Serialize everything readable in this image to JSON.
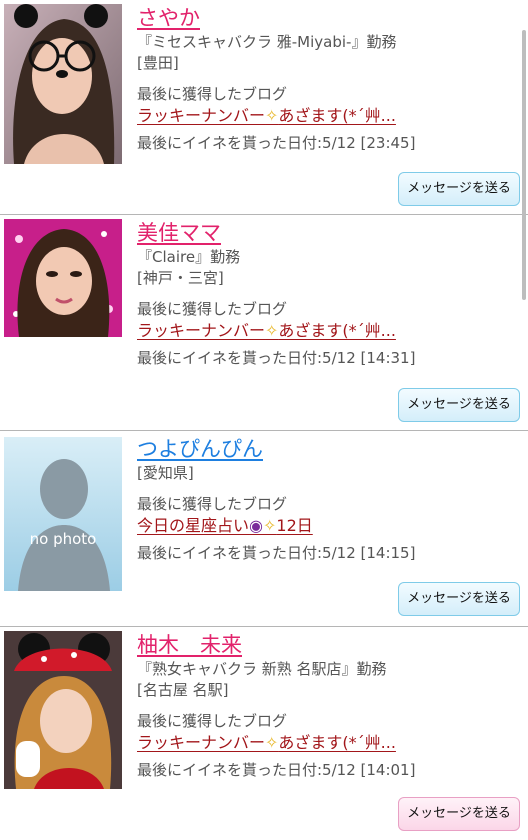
{
  "users": [
    {
      "name": "さやか",
      "gender": "female",
      "shop": "『ミセスキャバクラ 雅-Miyabi-』勤務",
      "area": "[豊田]",
      "blog_heading": "最後に獲得したブログ",
      "blog_link_a": "ラッキーナンバー",
      "blog_link_b": "あざます(*´艸...",
      "like_date": "最後にイイネを貰った日付:5/12 [23:45]",
      "button": "メッセージを送る",
      "button_style": "blue"
    },
    {
      "name": "美佳ママ",
      "gender": "female",
      "shop": "『Claire』勤務",
      "area": "[神戸・三宮]",
      "blog_heading": "最後に獲得したブログ",
      "blog_link_a": "ラッキーナンバー",
      "blog_link_b": "あざます(*´艸...",
      "like_date": "最後にイイネを貰った日付:5/12 [14:31]",
      "button": "メッセージを送る",
      "button_style": "blue"
    },
    {
      "name": "つよぴんぴん",
      "gender": "male",
      "no_photo": "no photo",
      "area": "[愛知県]",
      "blog_heading": "最後に獲得したブログ",
      "blog_link_a": "今日の星座占い",
      "blog_link_b": "12日",
      "like_date": "最後にイイネを貰った日付:5/12 [14:15]",
      "button": "メッセージを送る",
      "button_style": "blue"
    },
    {
      "name": "柚木　未来",
      "gender": "female",
      "shop": "『熟女キャバクラ 新熟 名駅店』勤務",
      "area": "[名古屋 名駅]",
      "blog_heading": "最後に獲得したブログ",
      "blog_link_a": "ラッキーナンバー",
      "blog_link_b": "あざます(*´艸...",
      "like_date": "最後にイイネを貰った日付:5/12 [14:01]",
      "button": "メッセージを送る",
      "button_style": "pink"
    }
  ],
  "colors": {
    "female_name": "#e2226b",
    "male_name": "#1e7fe0",
    "blog_link": "#a2161a"
  }
}
